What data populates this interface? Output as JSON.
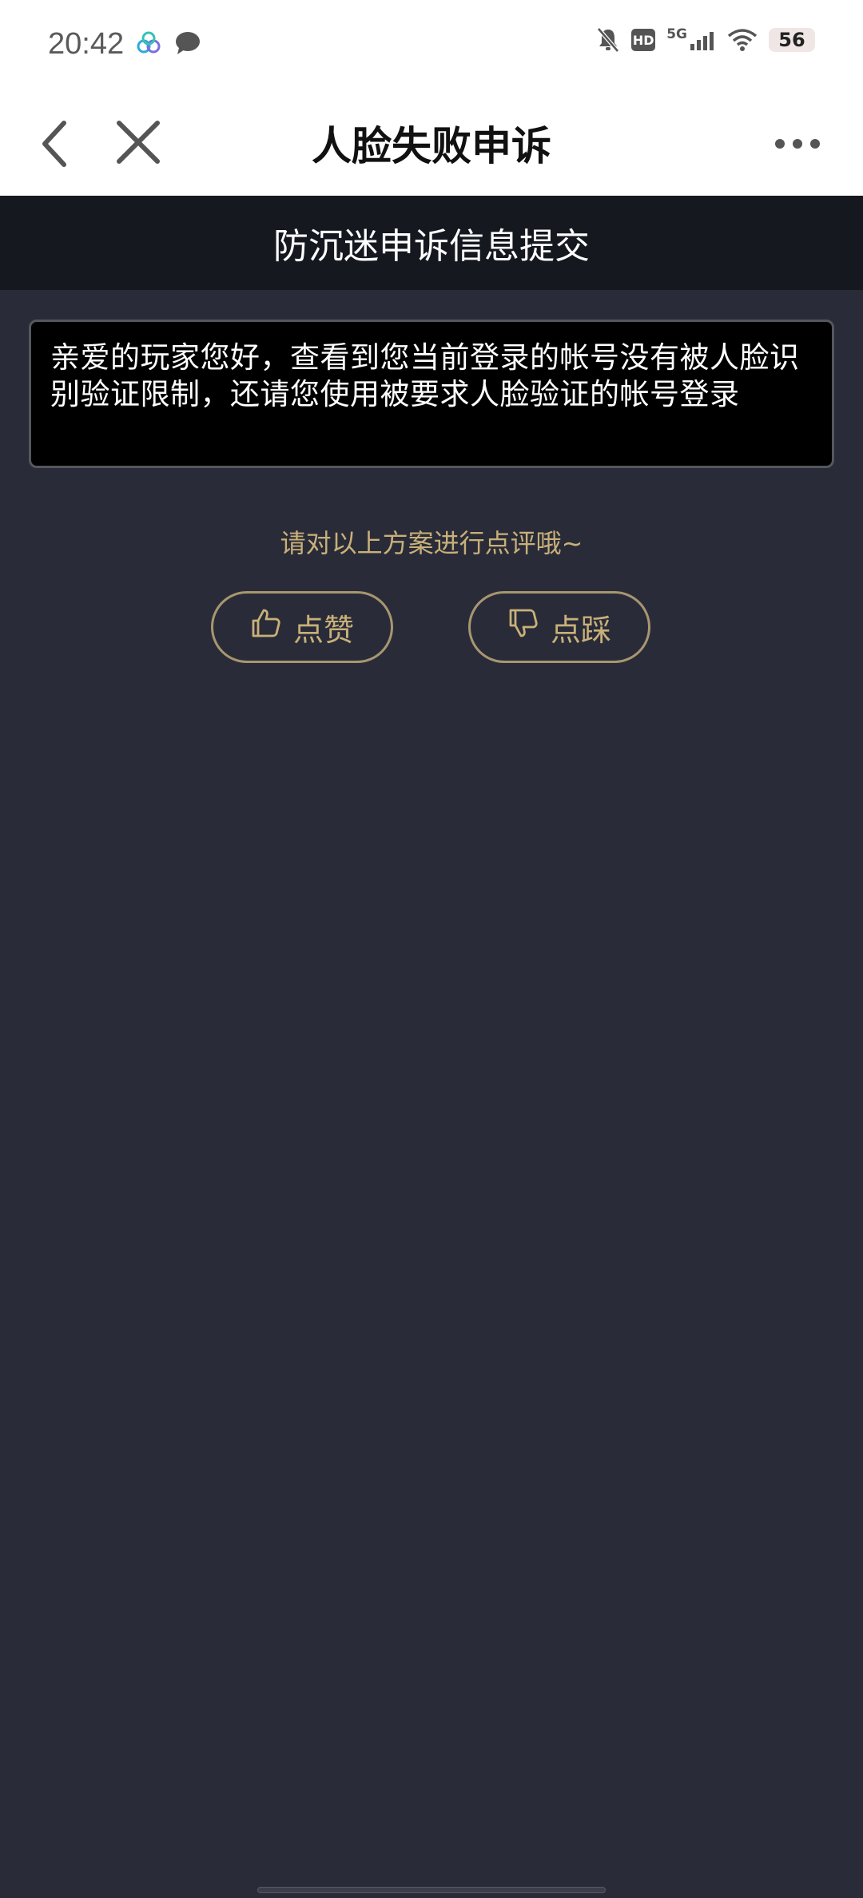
{
  "status_bar": {
    "time": "20:42",
    "icons_left": [
      "link-app-icon",
      "chat-bubble-icon"
    ],
    "icons_right": [
      "mute-bell-icon",
      "hd-icon",
      "signal-icon",
      "wifi-icon",
      "battery-icon"
    ],
    "hd_label": "HD",
    "network_label": "5G",
    "battery_level": "56"
  },
  "nav": {
    "title": "人脸失败申诉",
    "back_icon": "chevron-left-icon",
    "close_icon": "close-icon",
    "more_icon": "more-dots-icon"
  },
  "banner": {
    "title": "防沉迷申诉信息提交"
  },
  "message": {
    "text": "亲爱的玩家您好，查看到您当前登录的帐号没有被人脸识别验证限制，还请您使用被要求人脸验证的帐号登录"
  },
  "rating": {
    "prompt": "请对以上方案进行点评哦~",
    "like_label": "点赞",
    "dislike_label": "点踩"
  },
  "colors": {
    "accent_gold": "#c9b07a",
    "page_bg": "#292c38",
    "banner_bg": "#161820"
  }
}
